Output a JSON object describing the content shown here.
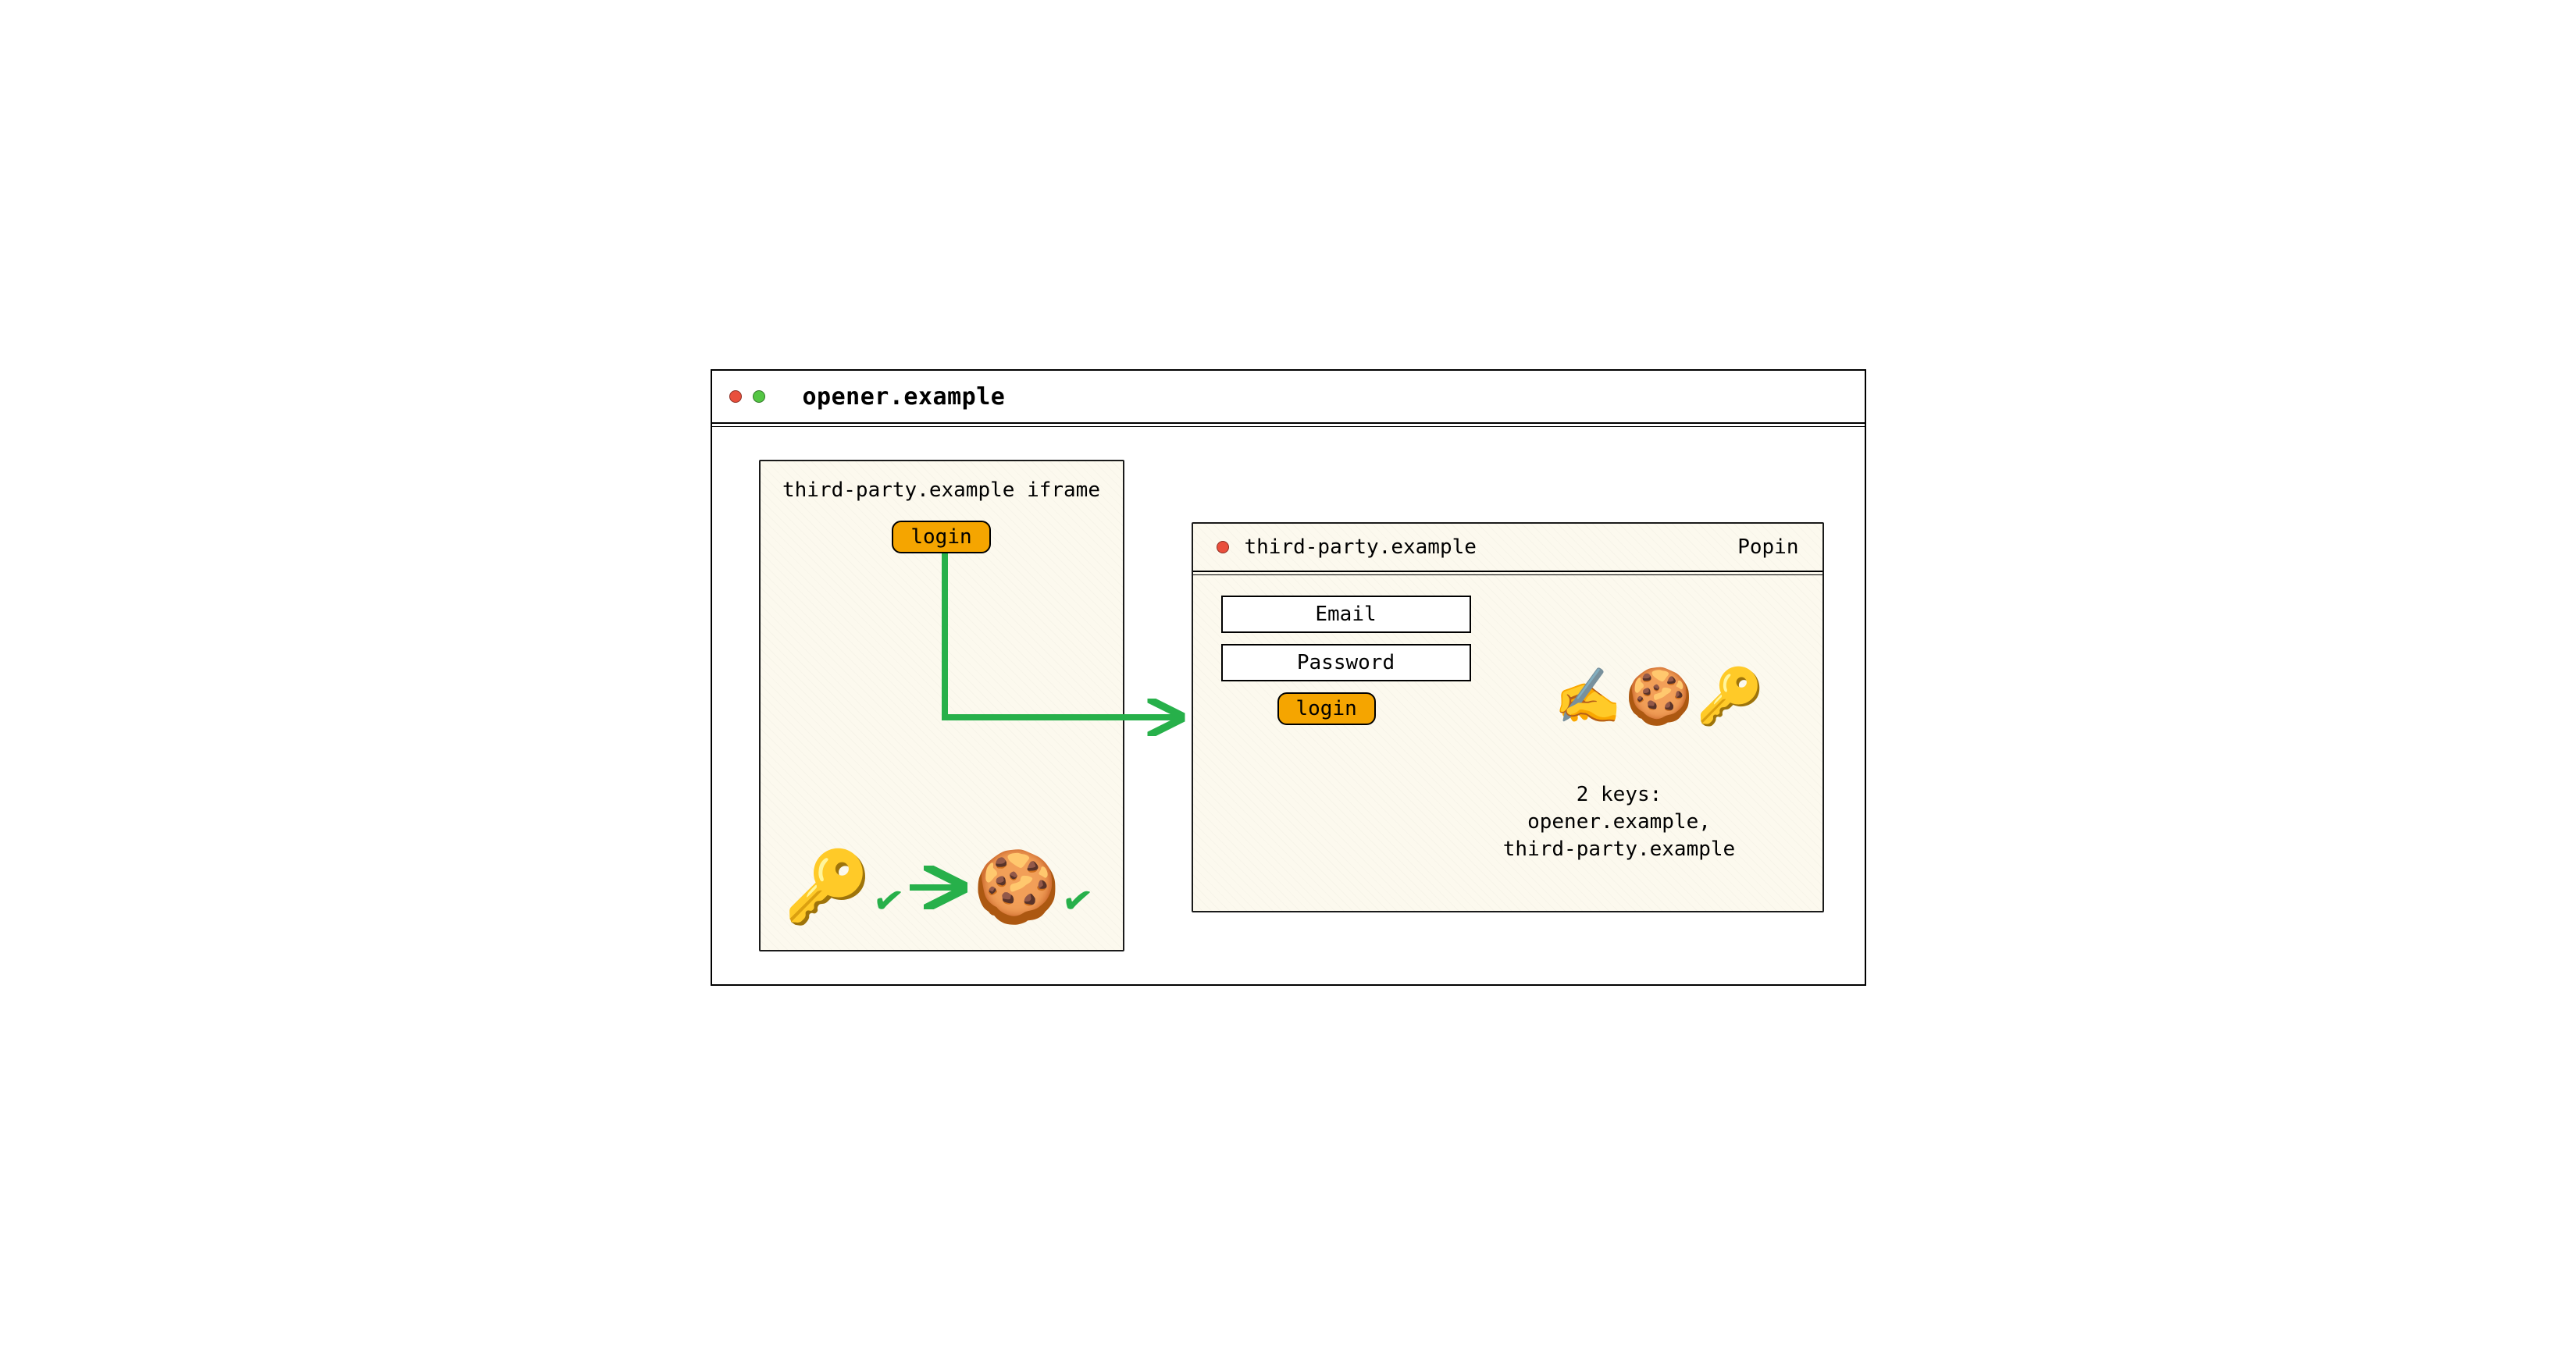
{
  "outer_window": {
    "title": "opener.example"
  },
  "iframe": {
    "title": "third-party.example iframe",
    "login_label": "login",
    "icons": {
      "key": "🔑",
      "cookie": "🍪"
    }
  },
  "popin": {
    "title": "third-party.example",
    "type_label": "Popin",
    "email_label": "Email",
    "password_label": "Password",
    "login_label": "login",
    "action_icons": "✍️🍪🔑",
    "keys_heading": "2 keys:",
    "keys_line1": "opener.example,",
    "keys_line2": "third-party.example"
  },
  "colors": {
    "accent": "#f5a500",
    "arrow": "#27b04a",
    "cream": "#fcf9ee"
  }
}
